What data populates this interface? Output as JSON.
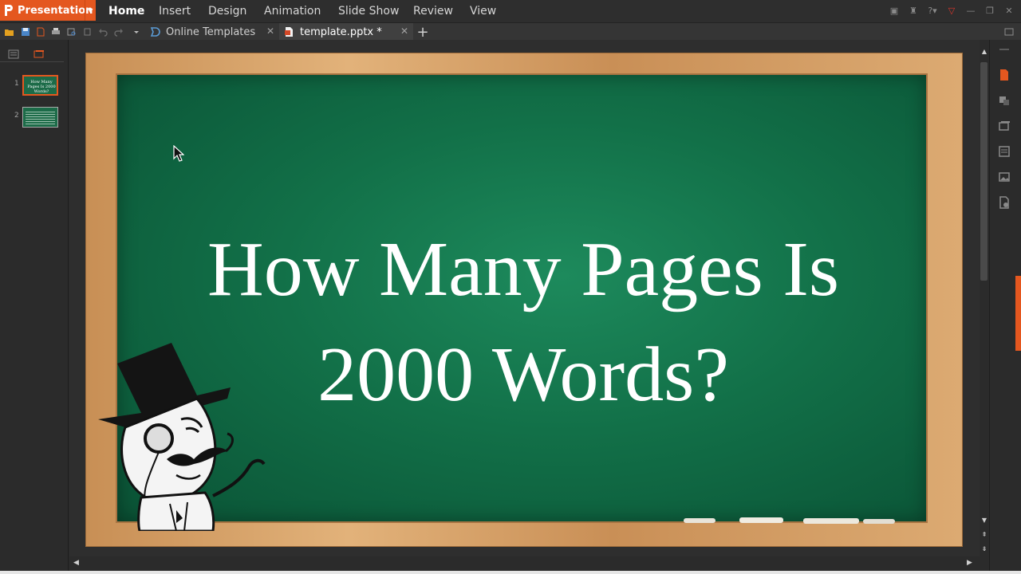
{
  "app": {
    "name": "Presentation",
    "accent": "#e4571f"
  },
  "menu": {
    "items": [
      "Home",
      "Insert",
      "Design",
      "Animation",
      "Slide Show",
      "Review",
      "View"
    ],
    "active": "Home"
  },
  "tabs": [
    {
      "label": "Online Templates",
      "icon": "online-templates-icon"
    },
    {
      "label": "template.pptx *",
      "icon": "pptx-file-icon",
      "active": true
    }
  ],
  "slides": {
    "numbers": [
      "1",
      "2"
    ],
    "thumb1_title": "How Many Pages Is 2000 Words?"
  },
  "current_slide": {
    "title_line1": "How Many Pages Is",
    "title_line2": "2000 Words?",
    "board_color": "#127048",
    "frame_color": "#d6a26a"
  }
}
